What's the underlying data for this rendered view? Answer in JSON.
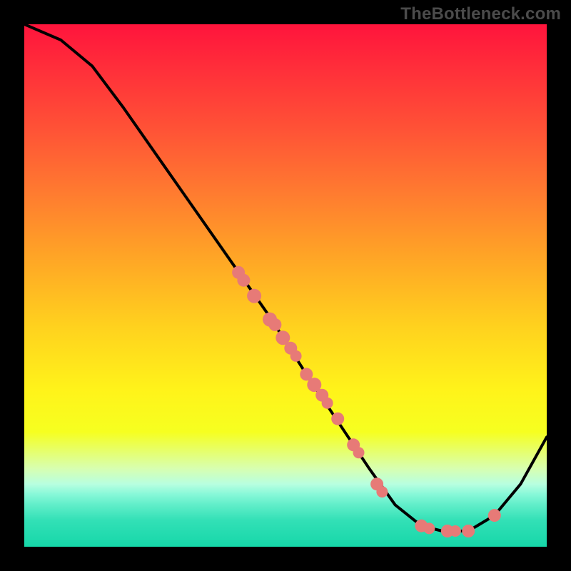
{
  "watermark": "TheBottleneck.com",
  "chart_data": {
    "type": "line",
    "title": "",
    "xlabel": "",
    "ylabel": "",
    "xlim": [
      0,
      100
    ],
    "ylim": [
      0,
      100
    ],
    "curve": [
      {
        "x": 0,
        "y": 100
      },
      {
        "x": 7,
        "y": 97
      },
      {
        "x": 13,
        "y": 92
      },
      {
        "x": 19,
        "y": 84
      },
      {
        "x": 26,
        "y": 74
      },
      {
        "x": 33,
        "y": 64
      },
      {
        "x": 40,
        "y": 54
      },
      {
        "x": 47,
        "y": 44
      },
      {
        "x": 54,
        "y": 33
      },
      {
        "x": 60,
        "y": 24
      },
      {
        "x": 66,
        "y": 15
      },
      {
        "x": 71,
        "y": 8
      },
      {
        "x": 76,
        "y": 4
      },
      {
        "x": 80,
        "y": 3
      },
      {
        "x": 85,
        "y": 3
      },
      {
        "x": 90,
        "y": 6
      },
      {
        "x": 95,
        "y": 12
      },
      {
        "x": 100,
        "y": 21
      }
    ],
    "markers": [
      {
        "x": 41,
        "y": 52.5,
        "r": 9
      },
      {
        "x": 42,
        "y": 51,
        "r": 9
      },
      {
        "x": 44,
        "y": 48,
        "r": 10
      },
      {
        "x": 47,
        "y": 43.5,
        "r": 10
      },
      {
        "x": 48,
        "y": 42.5,
        "r": 9
      },
      {
        "x": 49.5,
        "y": 40,
        "r": 10
      },
      {
        "x": 51,
        "y": 38,
        "r": 9
      },
      {
        "x": 52,
        "y": 36.5,
        "r": 8
      },
      {
        "x": 54,
        "y": 33,
        "r": 9
      },
      {
        "x": 55.5,
        "y": 31,
        "r": 10
      },
      {
        "x": 57,
        "y": 29,
        "r": 9
      },
      {
        "x": 58,
        "y": 27.5,
        "r": 8
      },
      {
        "x": 60,
        "y": 24.5,
        "r": 9
      },
      {
        "x": 63,
        "y": 19.5,
        "r": 9
      },
      {
        "x": 64,
        "y": 18,
        "r": 8
      },
      {
        "x": 67.5,
        "y": 12,
        "r": 9
      },
      {
        "x": 68.5,
        "y": 10.5,
        "r": 8
      },
      {
        "x": 76,
        "y": 4,
        "r": 9
      },
      {
        "x": 77.5,
        "y": 3.5,
        "r": 8
      },
      {
        "x": 81,
        "y": 3,
        "r": 9
      },
      {
        "x": 82.5,
        "y": 3,
        "r": 8
      },
      {
        "x": 85,
        "y": 3,
        "r": 9
      },
      {
        "x": 90,
        "y": 6,
        "r": 9
      }
    ]
  }
}
